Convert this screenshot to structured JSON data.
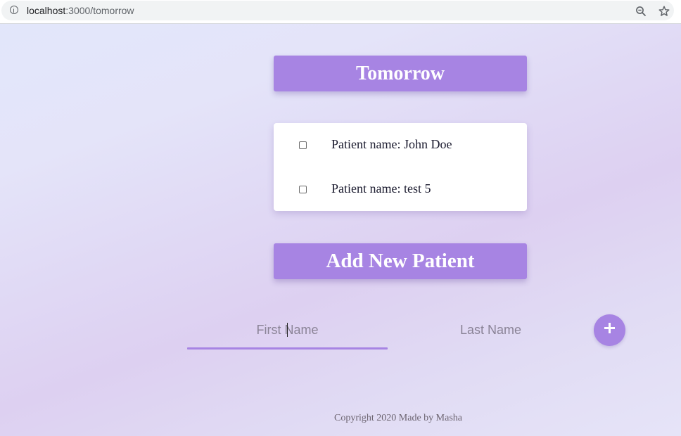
{
  "browser": {
    "url_host": "localhost",
    "url_path": ":3000/tomorrow",
    "icons": [
      "info-icon",
      "zoom-out-icon",
      "star-icon"
    ]
  },
  "main": {
    "title": "Tomorrow",
    "patients": [
      {
        "label": "Patient name: John Doe",
        "checked": false
      },
      {
        "label": "Patient name: test 5",
        "checked": false
      }
    ],
    "add_section_title": "Add New Patient"
  },
  "form": {
    "first_name_placeholder": "First Name",
    "last_name_placeholder": "Last Name",
    "add_icon": "plus-icon"
  },
  "footer": {
    "text": "Copyright 2020 Made by Masha"
  },
  "colors": {
    "accent": "#a784e3",
    "card": "#ffffff",
    "text": "#1a1a2e"
  }
}
